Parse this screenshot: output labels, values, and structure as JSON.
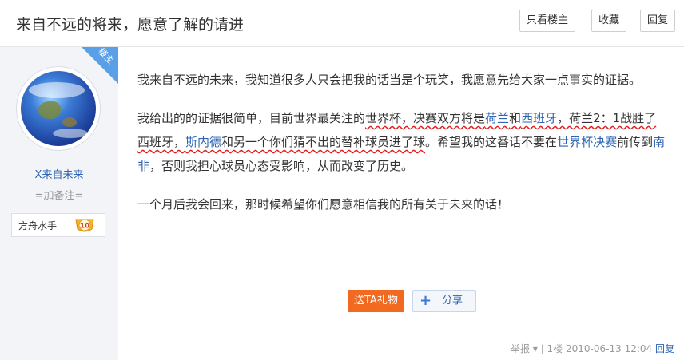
{
  "header": {
    "title": "来自不远的将来，愿意了解的请进",
    "buttons": {
      "only_op": "只看楼主",
      "favorite": "收藏",
      "reply": "回复"
    }
  },
  "author": {
    "badge": "楼主",
    "name": "X来自未来",
    "note": "=加备注=",
    "level_name": "方舟水手",
    "level_num": "10"
  },
  "post": {
    "para1": "我来自不远的未来，我知道很多人只会把我的话当是个玩笑，我愿意先给大家一点事实的证据。",
    "para2": {
      "p1": "我给出的的证据很简单，目前世界最关注的",
      "p2": "世界杯，决赛双方将是",
      "link1": "荷兰",
      "p3": "和",
      "link2": "西班牙",
      "p4": "，荷兰2：1战胜了",
      "p5": "西班牙，",
      "link3": "斯内德",
      "p6": "和另一个你们猜不出的替补球员进了球",
      "p7": "。希望我的这番话不要在",
      "link4": "世界杯决赛",
      "p8": "前传到",
      "link5": "南非",
      "p9": "，否则我担心球员心态受影响，从而改变了历史。"
    },
    "para3": "一个月后我会回来，那时候希望你们愿意相信我的所有关于未来的话！"
  },
  "actions": {
    "gift": "送TA礼物",
    "share": "分享"
  },
  "meta": {
    "report": "举报 ▾",
    "sep": " | ",
    "floor": "1楼",
    "date": "2010-06-13 12:04",
    "reply": "回复"
  },
  "colors": {
    "accent": "#2d64b3",
    "gift": "#f26a21",
    "sidebar": "#f2f4f8",
    "badge": "#5aa0e8"
  }
}
